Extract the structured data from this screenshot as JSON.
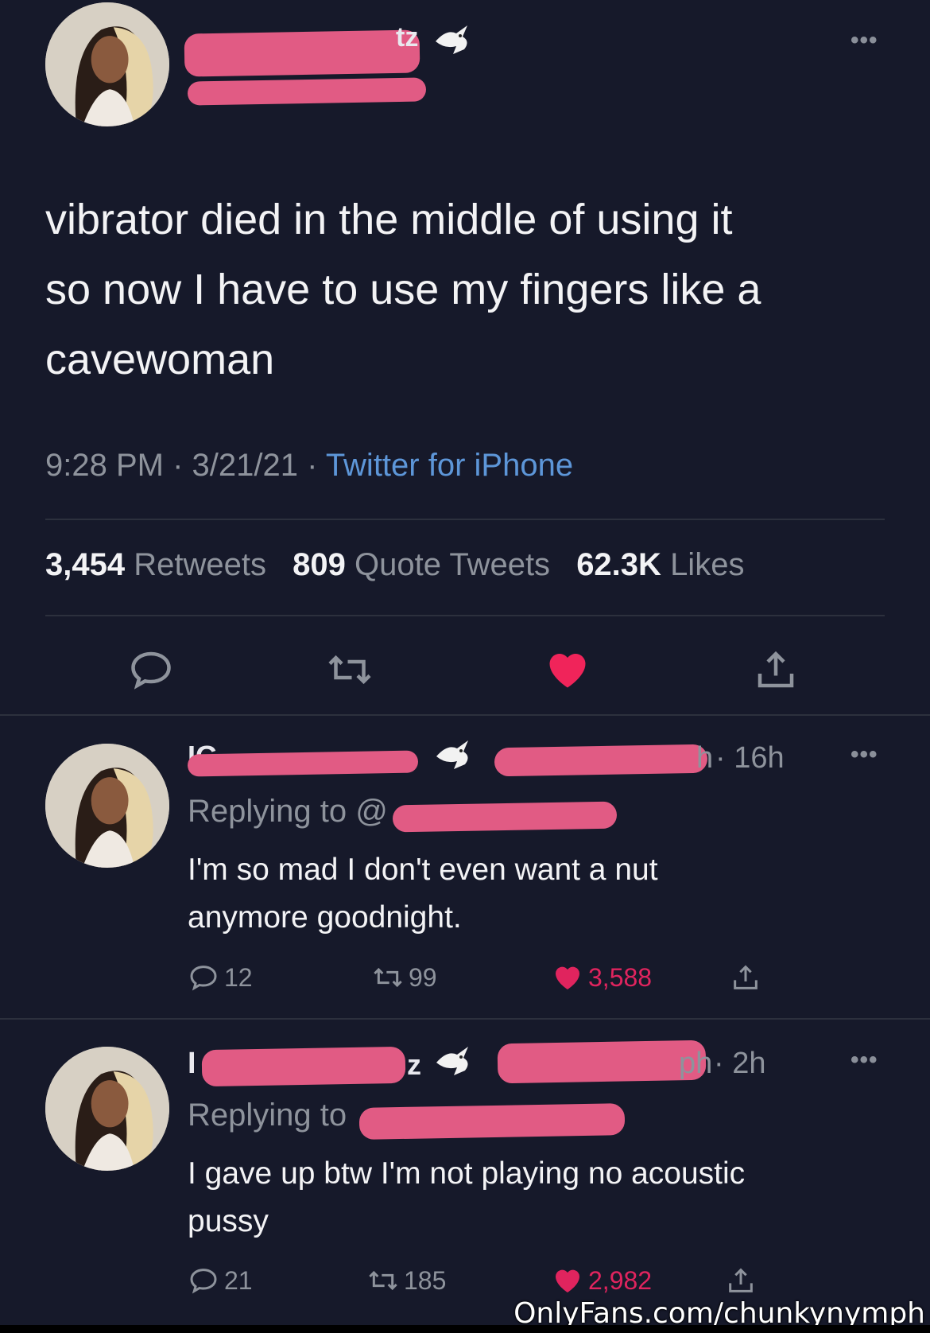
{
  "main_tweet": {
    "name_visible_fragment": "tz",
    "text": "vibrator died in the middle of using it\nso now I have to use my fingers like a\ncavewoman",
    "time": "9:28 PM",
    "date": "3/21/21",
    "source": "Twitter for iPhone",
    "separator": " · ",
    "more_label": "•••",
    "stats": [
      {
        "count": "3,454",
        "label": "Retweets"
      },
      {
        "count": "809",
        "label": "Quote Tweets"
      },
      {
        "count": "62.3K",
        "label": "Likes"
      }
    ],
    "icons": [
      "reply-icon",
      "retweet-icon",
      "liked-heart-icon",
      "share-icon"
    ]
  },
  "replies": [
    {
      "name_visible_fragment": "IG",
      "handle_end": "h",
      "ago": "· 16h",
      "replying_prefix": "Replying to @",
      "text": "I'm so mad I don't even want a nut\nanymore goodnight.",
      "reply_count": "12",
      "retweet_count": "99",
      "like_count": "3,588",
      "more_label": "•••"
    },
    {
      "name_visible_fragment": "I",
      "name_tail": "z",
      "handle_end": "ph",
      "ago": "· 2h",
      "replying_prefix": "Replying to",
      "text": "I gave up btw I'm not playing no acoustic\npussy",
      "reply_count": "21",
      "retweet_count": "185",
      "like_count": "2,982",
      "more_label": "•••"
    }
  ],
  "watermark": "OnlyFans.com/chunkynymph",
  "colors": {
    "background": "#16192a",
    "redaction": "#e15b84",
    "like": "#e0245e",
    "link": "#5d96d8",
    "muted": "#8e939c"
  }
}
